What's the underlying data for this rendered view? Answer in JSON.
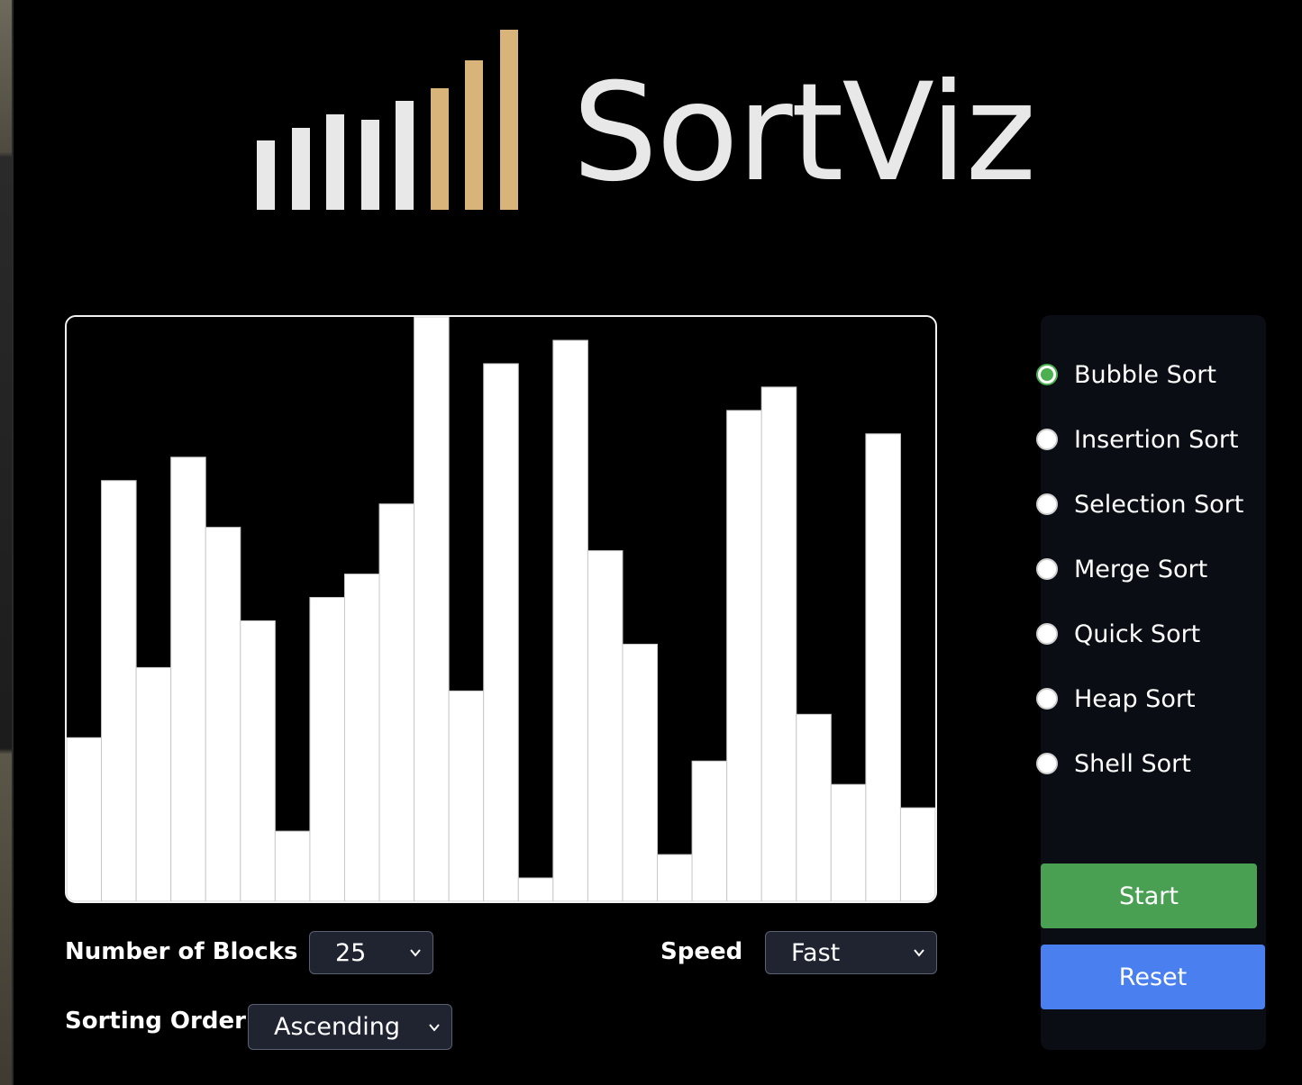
{
  "app": {
    "logo_text": "SortViz",
    "logo_bars": [
      {
        "value": 62,
        "color": "#e8e8e8"
      },
      {
        "value": 73,
        "color": "#e8e8e8"
      },
      {
        "value": 85,
        "color": "#e8e8e8"
      },
      {
        "value": 80,
        "color": "#e8e8e8"
      },
      {
        "value": 97,
        "color": "#e8e8e8"
      },
      {
        "value": 108,
        "color": "#d8b47a"
      },
      {
        "value": 133,
        "color": "#d8b47a"
      },
      {
        "value": 160,
        "color": "#d8b47a"
      }
    ]
  },
  "chart_data": {
    "type": "bar",
    "values": [
      28,
      72,
      40,
      76,
      64,
      48,
      12,
      52,
      56,
      68,
      100,
      36,
      92,
      4,
      96,
      60,
      44,
      8,
      24,
      84,
      88,
      32,
      20,
      80,
      16
    ],
    "ylim": [
      0,
      100
    ],
    "bar_color": "#ffffff",
    "background": "#000000"
  },
  "controls": {
    "blocks_label": "Number of Blocks",
    "blocks_value": "25",
    "speed_label": "Speed",
    "speed_value": "Fast",
    "order_label": "Sorting Order",
    "order_value": "Ascending"
  },
  "algorithms": [
    {
      "label": "Bubble Sort",
      "checked": true
    },
    {
      "label": "Insertion Sort",
      "checked": false
    },
    {
      "label": "Selection Sort",
      "checked": false
    },
    {
      "label": "Merge Sort",
      "checked": false
    },
    {
      "label": "Quick Sort",
      "checked": false
    },
    {
      "label": "Heap Sort",
      "checked": false
    },
    {
      "label": "Shell Sort",
      "checked": false
    }
  ],
  "buttons": {
    "start": "Start",
    "reset": "Reset"
  },
  "colors": {
    "accent_green": "#4aa052",
    "accent_blue": "#4a7ff0",
    "logo_gold": "#d8b47a"
  }
}
